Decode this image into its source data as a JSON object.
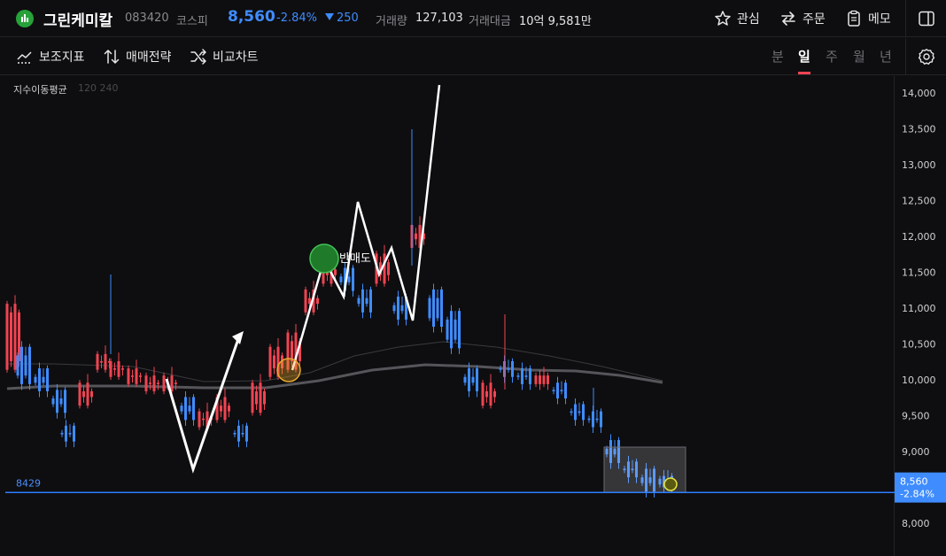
{
  "header": {
    "stock_name": "그린케미칼",
    "stock_code": "083420",
    "market": "코스피",
    "price": "8,560",
    "change_pct": "-2.84%",
    "change_amt": "250",
    "volume_label": "거래량",
    "volume_value": "127,103",
    "amount_label": "거래대금",
    "amount_value": "10억 9,581만",
    "watch_label": "관심",
    "order_label": "주문",
    "memo_label": "메모"
  },
  "toolbar": {
    "indicators_label": "보조지표",
    "strategy_label": "매매전략",
    "compare_label": "비교차트",
    "periods": [
      "분",
      "일",
      "주",
      "월",
      "년"
    ],
    "active_period": "일"
  },
  "chart_data": {
    "type": "candlestick",
    "ma_label": "지수이동평균",
    "ma_params": "120 240",
    "y_ticks": [
      "14,000",
      "13,500",
      "13,000",
      "12,500",
      "12,000",
      "11,500",
      "11,000",
      "10,500",
      "10,000",
      "9,500",
      "9,000",
      "8,000"
    ],
    "ylim": [
      7850,
      14100
    ],
    "support_line_label": "8429",
    "support_line_value": 8429,
    "current_price_label": "8,560",
    "current_change_label": "-2.84%",
    "annotation_text": "반매도",
    "colors": {
      "up": "#f04452",
      "down": "#3f8cff",
      "support": "#2f7fff",
      "background": "#0e0e10"
    }
  }
}
